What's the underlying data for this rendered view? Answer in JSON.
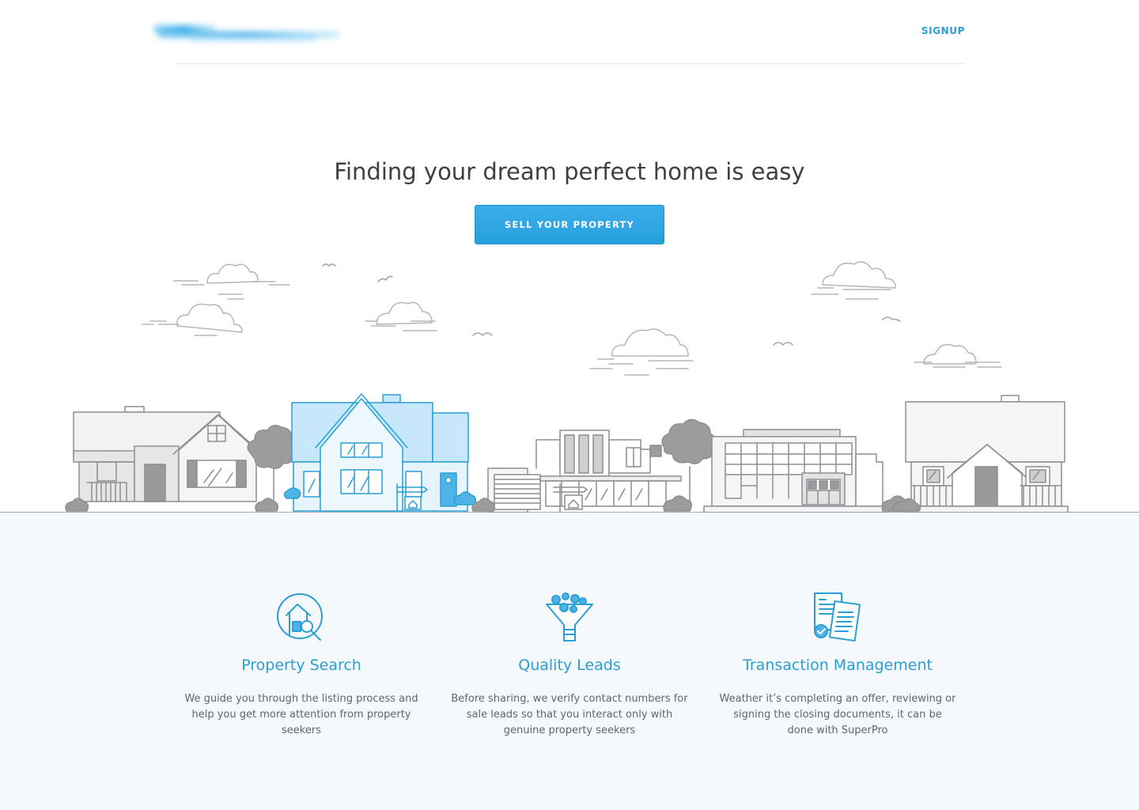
{
  "header": {
    "signup_label": "SIGNUP"
  },
  "hero": {
    "title": "Finding your dream perfect home is easy",
    "cta_label": "SELL YOUR PROPERTY"
  },
  "features": [
    {
      "icon": "house-search-icon",
      "title": "Property Search",
      "text": "We guide you through the listing process and help you get more attention from property seekers"
    },
    {
      "icon": "funnel-icon",
      "title": "Quality Leads",
      "text": "Before sharing, we verify contact numbers for sale leads so that you interact only with genuine property seekers"
    },
    {
      "icon": "documents-icon",
      "title": "Transaction Management",
      "text": "Weather it’s completing an offer, reviewing or signing the closing documents, it can be done with SuperPro"
    }
  ],
  "colors": {
    "accent": "#2a9fd6",
    "line": "#8a8f94",
    "house_fill": "#e6e6e6",
    "highlight_fill": "#c7e7fa",
    "features_bg": "#f5f9fc"
  }
}
